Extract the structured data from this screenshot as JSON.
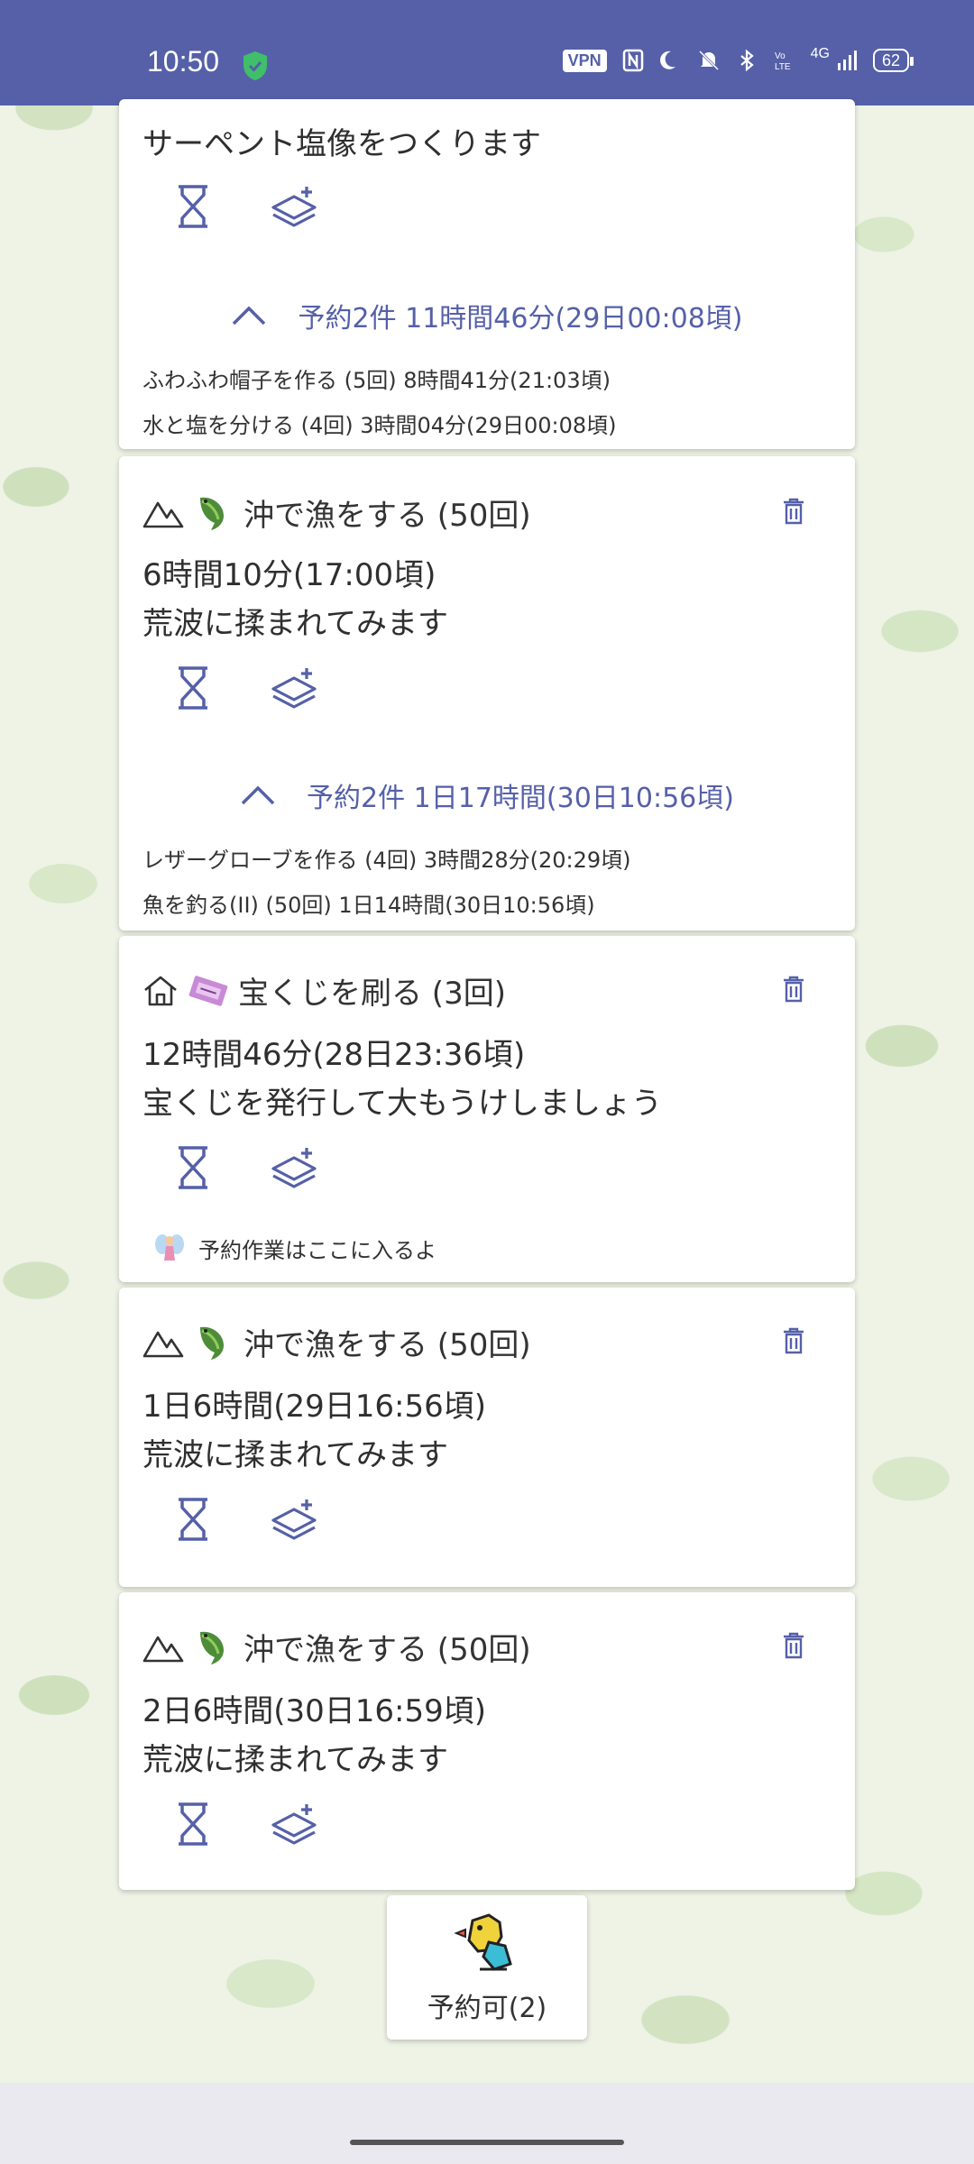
{
  "status_bar": {
    "time": "10:50",
    "vpn": "VPN",
    "network": "4G",
    "battery": "62"
  },
  "cards": [
    {
      "description": "サーペント塩像をつくります",
      "reservation": {
        "summary": "予約2件 11時間46分(29日00:08頃)",
        "items": [
          "ふわふわ帽子を作る (5回) 8時間41分(21:03頃)",
          "水と塩を分ける (4回) 3時間04分(29日00:08頃)"
        ]
      }
    },
    {
      "title": "沖で漁をする (50回)",
      "duration": "6時間10分(17:00頃)",
      "description": "荒波に揉まれてみます",
      "reservation": {
        "summary": "予約2件 1日17時間(30日10:56頃)",
        "items": [
          "レザーグローブを作る (4回) 3時間28分(20:29頃)",
          "魚を釣る(II) (50回) 1日14時間(30日10:56頃)"
        ]
      }
    },
    {
      "title": "宝くじを刷る (3回)",
      "duration": "12時間46分(28日23:36頃)",
      "description": "宝くじを発行して大もうけしましょう",
      "note": "予約作業はここに入るよ"
    },
    {
      "title": "沖で漁をする (50回)",
      "duration": "1日6時間(29日16:56頃)",
      "description": "荒波に揉まれてみます"
    },
    {
      "title": "沖で漁をする (50回)",
      "duration": "2日6時間(30日16:59頃)",
      "description": "荒波に揉まれてみます"
    }
  ],
  "reserve_button": {
    "label": "予約可(2)"
  },
  "icons": {
    "location_mountain": "mountain-icon",
    "location_home": "home-icon",
    "fish": "fish-icon",
    "ticket": "lottery-ticket-icon",
    "trash": "trash-icon",
    "hourglass": "hourglass-icon",
    "layers_add": "layers-add-icon",
    "chevron": "chevron-up-icon",
    "fairy": "fairy-icon",
    "bird": "bird-icon"
  },
  "colors": {
    "accent": "#5560a8",
    "status_bar": "#5560a8",
    "shield": "#3fbf6a"
  }
}
